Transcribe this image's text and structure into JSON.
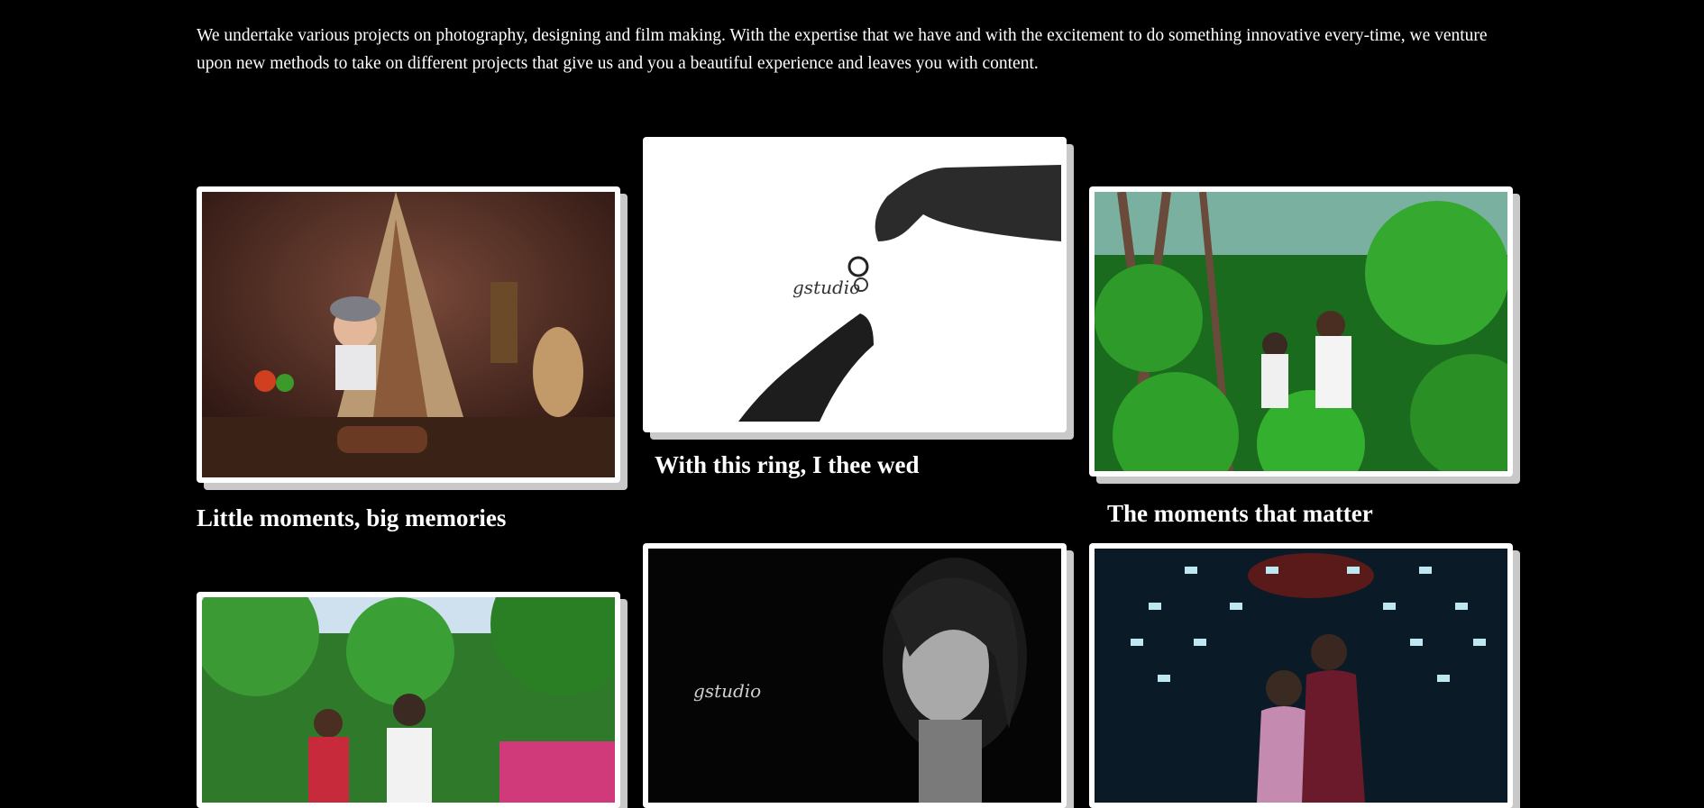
{
  "intro": {
    "text": "We undertake various projects on photography, designing and film making. With the expertise that we have and with the excitement to do something innovative every-time, we venture upon new methods to take on different projects that give us and you a beautiful experience and leaves you with content."
  },
  "gallery": [
    {
      "caption": "Little moments, big memories",
      "image": "baby-photoshoot-photo"
    },
    {
      "caption": "With this ring, I thee wed",
      "image": "ring-exchange-photo",
      "watermark": "gstudio"
    },
    {
      "caption": "The moments that matter",
      "image": "couple-in-garden-photo"
    },
    {
      "caption": "",
      "image": "wedding-couple-outdoor-photo"
    },
    {
      "caption": "",
      "image": "bride-portrait-bw-photo",
      "watermark": "gstudio"
    },
    {
      "caption": "",
      "image": "couple-indoor-hall-photo"
    }
  ],
  "colors": {
    "background": "#000000",
    "text": "#ffffff",
    "card_border": "#ffffff"
  }
}
